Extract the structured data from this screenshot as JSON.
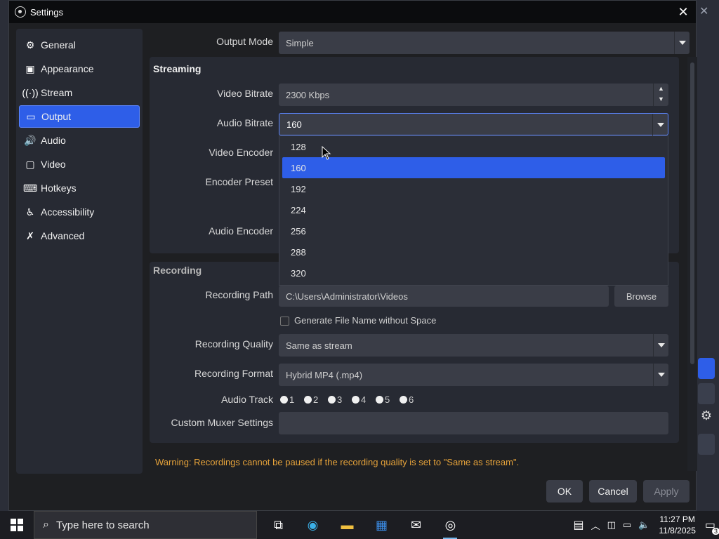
{
  "window": {
    "title": "Settings"
  },
  "sidebar": {
    "items": [
      {
        "label": "General",
        "icon": "gear-icon"
      },
      {
        "label": "Appearance",
        "icon": "palette-icon"
      },
      {
        "label": "Stream",
        "icon": "broadcast-icon"
      },
      {
        "label": "Output",
        "icon": "monitor-icon"
      },
      {
        "label": "Audio",
        "icon": "speaker-icon"
      },
      {
        "label": "Video",
        "icon": "screen-icon"
      },
      {
        "label": "Hotkeys",
        "icon": "keyboard-icon"
      },
      {
        "label": "Accessibility",
        "icon": "accessibility-icon"
      },
      {
        "label": "Advanced",
        "icon": "wrench-icon"
      }
    ],
    "active": "Output"
  },
  "output": {
    "mode_label": "Output Mode",
    "mode_value": "Simple",
    "streaming": {
      "title": "Streaming",
      "video_bitrate_label": "Video Bitrate",
      "video_bitrate_value": "2300 Kbps",
      "audio_bitrate_label": "Audio Bitrate",
      "audio_bitrate_value": "160",
      "video_encoder_label": "Video Encoder",
      "encoder_preset_label": "Encoder Preset",
      "audio_encoder_label": "Audio Encoder"
    },
    "audio_bitrate_options": [
      "128",
      "160",
      "192",
      "224",
      "256",
      "288",
      "320"
    ],
    "audio_bitrate_selected": "160",
    "recording": {
      "title": "Recording",
      "path_label": "Recording Path",
      "path_value": "C:\\Users\\Administrator\\Videos",
      "browse_label": "Browse",
      "no_space_label": "Generate File Name without Space",
      "quality_label": "Recording Quality",
      "quality_value": "Same as stream",
      "format_label": "Recording Format",
      "format_value": "Hybrid MP4 (.mp4)",
      "audio_track_label": "Audio Track",
      "tracks": [
        "1",
        "2",
        "3",
        "4",
        "5",
        "6"
      ],
      "muxer_label": "Custom Muxer Settings",
      "muxer_value": ""
    },
    "warning": "Warning: Recordings cannot be paused if the recording quality is set to \"Same as stream\"."
  },
  "buttons": {
    "ok": "OK",
    "cancel": "Cancel",
    "apply": "Apply"
  },
  "taskbar": {
    "search_placeholder": "Type here to search",
    "time": "11:27 PM",
    "date": "11/8/2025",
    "notification_count": "3"
  },
  "colors": {
    "accent": "#2e5ee8",
    "warning": "#e5a23a"
  }
}
